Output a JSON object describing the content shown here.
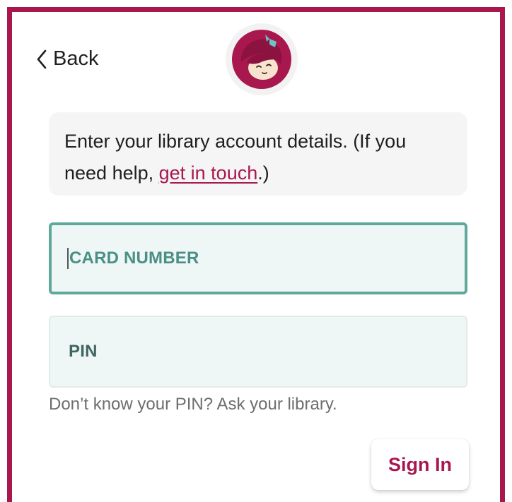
{
  "header": {
    "back_label": "Back",
    "logo_icon": "libby-logo-icon"
  },
  "info": {
    "text_before": "Enter your library account details. (If you need help, ",
    "link_text": "get in touch",
    "text_after": ".)"
  },
  "form": {
    "card_number_placeholder": "CARD NUMBER",
    "pin_placeholder": "PIN",
    "pin_hint": "Don’t know your PIN? Ask your library.",
    "submit_label": "Sign In"
  },
  "colors": {
    "brand": "#a8184f",
    "field_focus_border": "#5fa89b",
    "field_background": "#eef7f5"
  }
}
